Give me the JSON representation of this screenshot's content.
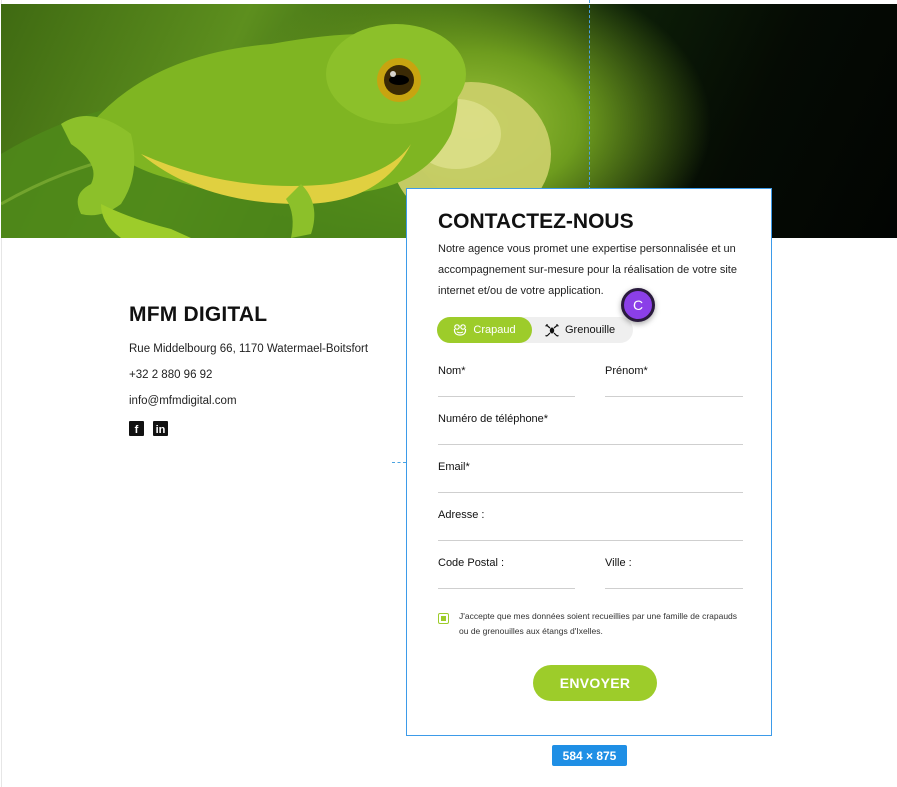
{
  "hero": {
    "alt": "frog-photo"
  },
  "company": {
    "name": "MFM DIGITAL",
    "address": "Rue Middelbourg 66, 1170 Watermael-Boitsfort",
    "phone": "+32 2 880 96 92",
    "email": "info@mfmdigital.com",
    "socials": [
      {
        "icon": "facebook-icon",
        "glyph": "f"
      },
      {
        "icon": "linkedin-icon",
        "glyph": "in"
      }
    ]
  },
  "form": {
    "title": "CONTACTEZ-NOUS",
    "description": "Notre agence vous promet une expertise personnalisée et un accompagnement sur-mesure pour la réalisation de votre site internet et/ou de votre application.",
    "toggle": {
      "options": [
        {
          "label": "Crapaud",
          "icon": "toad-icon",
          "selected": true
        },
        {
          "label": "Grenouille",
          "icon": "frog-icon",
          "selected": false
        }
      ]
    },
    "fields": {
      "nom": "Nom*",
      "prenom": "Prénom*",
      "telephone": "Numéro de téléphone*",
      "email": "Email*",
      "adresse": "Adresse :",
      "code_postal": "Code Postal :",
      "ville": "Ville :"
    },
    "consent": "J'accepte que mes données soient recueillies par une famille de crapauds ou de grenouilles aux étangs d'Ixelles.",
    "submit": "ENVOYER"
  },
  "editor": {
    "avatar_initial": "C",
    "dimensions": "584 × 875"
  },
  "colors": {
    "accent_green": "#9dcc2a",
    "selection_blue": "#3d9be9",
    "avatar_purple": "#8b3fe8"
  }
}
